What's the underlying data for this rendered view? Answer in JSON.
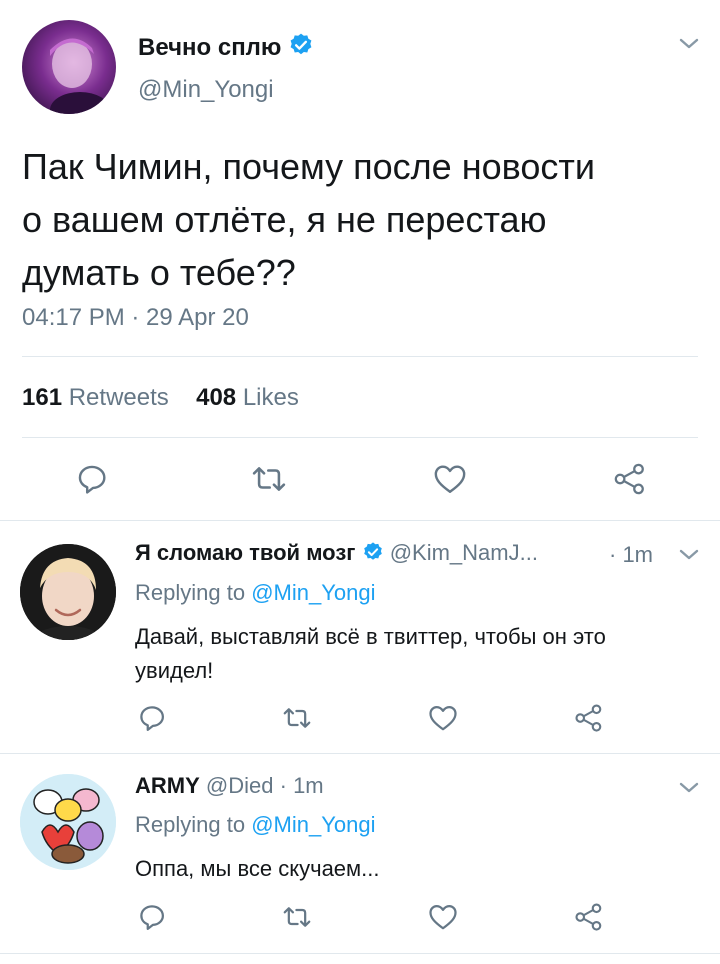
{
  "main_tweet": {
    "display_name": "Вечно сплю",
    "handle": "@Min_Yongi",
    "text_lines": [
      "Пак Чимин, почему после новости",
      "о вашем отлёте, я не перестаю",
      "думать о тебе??"
    ],
    "timestamp": "04:17 PM · 29 Apr 20",
    "retweets_count": "161",
    "retweets_label": "Retweets",
    "likes_count": "408",
    "likes_label": "Likes"
  },
  "replies": [
    {
      "display_name": "Я сломаю твой мозг",
      "handle": "@Kim_NamJ...",
      "time": "· 1m",
      "replying_prefix": "Replying to",
      "replying_handle": "@Min_Yongi",
      "text_lines": [
        "Давай, выставляй всё в твиттер, чтобы он это",
        "увидел!"
      ]
    },
    {
      "display_name": "ARMY",
      "handle": "@Died",
      "time": "· 1m",
      "replying_prefix": "Replying to",
      "replying_handle": "@Min_Yongi",
      "text_lines": [
        "Оппа, мы все скучаем..."
      ]
    }
  ],
  "colors": {
    "verified": "#1da1f2",
    "link": "#1da1f2",
    "gray": "#657786"
  }
}
